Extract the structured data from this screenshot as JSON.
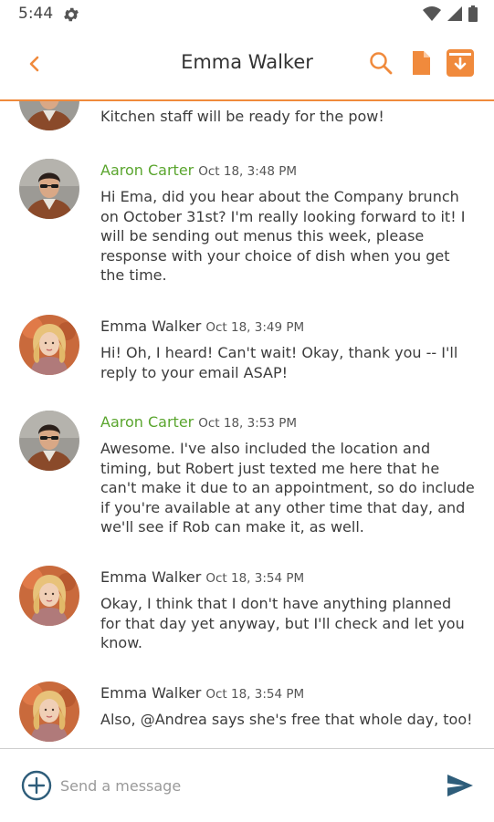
{
  "status": {
    "time": "5:44"
  },
  "header": {
    "title": "Emma Walker"
  },
  "partial_message": {
    "text": "Kitchen staff will be ready for the pow!"
  },
  "messages": [
    {
      "sender": "Aaron Carter",
      "time": "Oct 18, 3:48 PM",
      "text": "Hi Ema, did you hear about the Company brunch on October 31st? I'm really looking forward to it! I will be sending out menus this week, please response with your choice of dish when you get the time."
    },
    {
      "sender": "Emma Walker",
      "time": "Oct 18, 3:49 PM",
      "text": "Hi! Oh, I heard! Can't wait! Okay, thank you -- I'll reply to your email ASAP!"
    },
    {
      "sender": "Aaron Carter",
      "time": "Oct 18, 3:53 PM",
      "text": "Awesome. I've also included the location and timing, but Robert just texted me here that he can't make it due to an appointment, so do include if you're available at any other time that day, and we'll see if Rob can make it, as well."
    },
    {
      "sender": "Emma Walker",
      "time": "Oct 18, 3:54 PM",
      "text": "Okay, I think that I don't have anything planned for that day yet anyway, but I'll check and let you know."
    },
    {
      "sender": "Emma Walker",
      "time": "Oct 18, 3:54 PM",
      "text": "Also, @Andrea says she's free that whole day, too!"
    }
  ],
  "composer": {
    "placeholder": "Send a message"
  },
  "colors": {
    "accent": "#f08a3c",
    "sender_green": "#5aa52e",
    "text": "#3c3c3c"
  }
}
